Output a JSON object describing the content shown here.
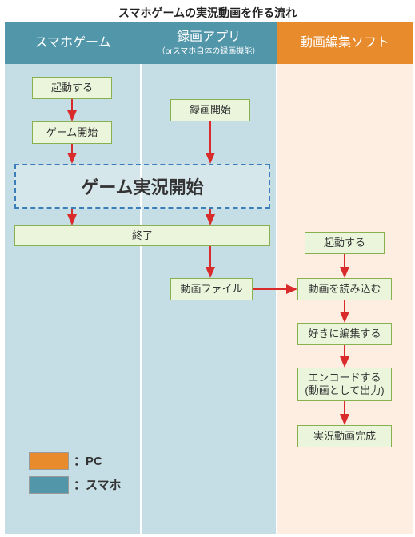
{
  "title": "スマホゲームの実況動画を作る流れ",
  "columns": {
    "c1": {
      "label": "スマホゲーム"
    },
    "c2": {
      "label": "録画アプリ",
      "sublabel": "（orスマホ自体の録画機能）"
    },
    "c3": {
      "label": "動画編集ソフト"
    }
  },
  "nodes": {
    "launch_game": "起動する",
    "start_game": "ゲーム開始",
    "big": "ゲーム実況開始",
    "start_rec": "録画開始",
    "end": "終了",
    "video_file": "動画ファイル",
    "launch_editor": "起動する",
    "load_video": "動画を読み込む",
    "edit": "好きに編集する",
    "encode": "エンコードする\n(動画として出力)",
    "done": "実況動画完成"
  },
  "legend": {
    "pc": "：PC",
    "phone": "：スマホ"
  },
  "colors": {
    "orange": "#e88b2d",
    "teal": "#5296aa",
    "arrow": "#d92b2b"
  }
}
